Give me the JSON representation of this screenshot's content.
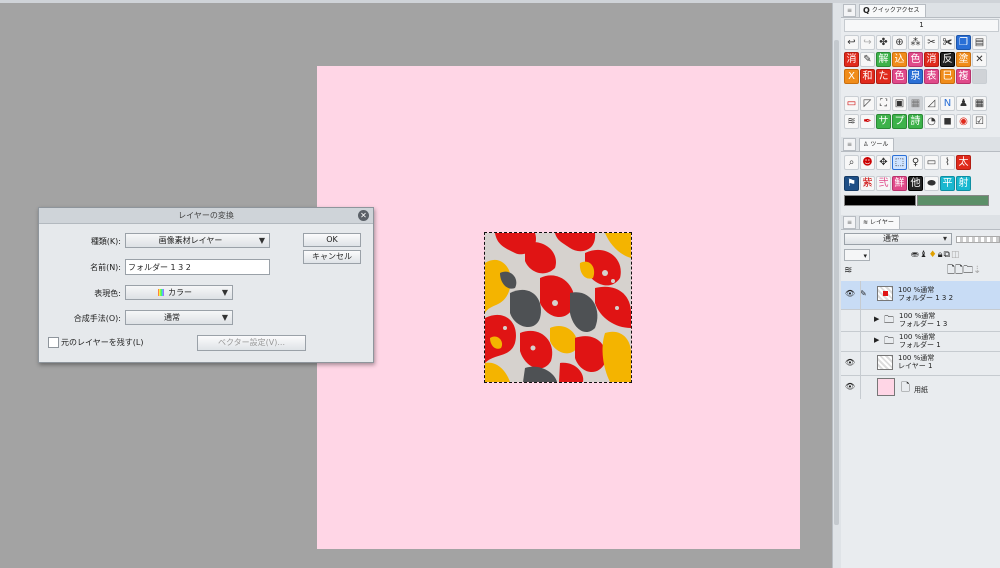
{
  "quick_access": {
    "tab_label": "クイックアクセス",
    "page_number": "1",
    "rows": [
      [
        "undo-icon",
        "redo-icon",
        "puppet-icon",
        "target-icon",
        "cut-icon",
        "cut2-icon",
        "scissors-icon",
        "copy-icon",
        "paste-icon"
      ],
      [
        "消",
        "brush-icon",
        "解",
        "込",
        "色",
        "消",
        "反",
        "塗",
        "close-x-icon"
      ],
      [
        "X",
        "和",
        "た",
        "色",
        "泉",
        "表",
        "巳",
        "複",
        "blank-icon"
      ],
      [
        "shape-icon",
        "selection-icon",
        "frame-icon",
        "square-icon",
        "stamp-icon",
        "ruler-icon",
        "N",
        "figure-icon",
        "grid-icon"
      ],
      [
        "layers-icon",
        "pen-icon",
        "サ",
        "プ",
        "詩",
        "gauge-icon",
        "palette-icon",
        "color-wheel-icon",
        "check-icon"
      ]
    ],
    "text_cells": {
      "row1": [
        "消",
        "",
        "解",
        "込",
        "色",
        "消",
        "反",
        "塗",
        ""
      ],
      "row2": [
        "X",
        "和",
        "た",
        "色",
        "泉",
        "表",
        "巳",
        "複",
        ""
      ],
      "row4": [
        "",
        "",
        "サ",
        "プ",
        "詩",
        "",
        "",
        "",
        ""
      ]
    }
  },
  "tool_panel": {
    "tab_label": "ツール",
    "row1_text": [
      "",
      "",
      "",
      "",
      "",
      "",
      "",
      "太"
    ],
    "row2_text": [
      "",
      "紫",
      "弐",
      "鮮",
      "他",
      "",
      "平",
      "射"
    ]
  },
  "layer_panel": {
    "tab_label": "レイヤー",
    "blend_mode": "通常",
    "layers": [
      {
        "opacity_mode": "100 %通常",
        "name": "フォルダー 1 3 2",
        "visible": true,
        "type": "image",
        "selected": true
      },
      {
        "opacity_mode": "100 %通常",
        "name": "フォルダー 1 3",
        "visible": false,
        "type": "folder",
        "selected": false
      },
      {
        "opacity_mode": "100 %通常",
        "name": "フォルダー 1",
        "visible": false,
        "type": "folder",
        "selected": false
      },
      {
        "opacity_mode": "100 %通常",
        "name": "レイヤー 1",
        "visible": true,
        "type": "raster",
        "selected": false
      },
      {
        "opacity_mode": "",
        "name": "用紙",
        "visible": true,
        "type": "paper",
        "selected": false
      }
    ]
  },
  "dialog": {
    "title": "レイヤーの変換",
    "type_label": "種類(K):",
    "type_value": "画像素材レイヤー",
    "name_label": "名前(N):",
    "name_value": "フォルダー 1 3 2",
    "expression_label": "表現色:",
    "expression_value": "カラー",
    "blend_label": "合成手法(O):",
    "blend_value": "通常",
    "keep_original_label": "元のレイヤーを残す(L)",
    "keep_original_checked": false,
    "vector_settings_label": "ベクター設定(V)...",
    "ok_label": "OK",
    "cancel_label": "キャンセル"
  },
  "colors": {
    "canvas_bg": "#a3a3a3",
    "paper": "#ffd6e6",
    "camo_red": "#e01414",
    "camo_yellow": "#f4b400",
    "camo_grey": "#4e5154",
    "camo_light": "#d6d2ce",
    "sub_color": "#5c8f68",
    "main_color": "#000000"
  }
}
